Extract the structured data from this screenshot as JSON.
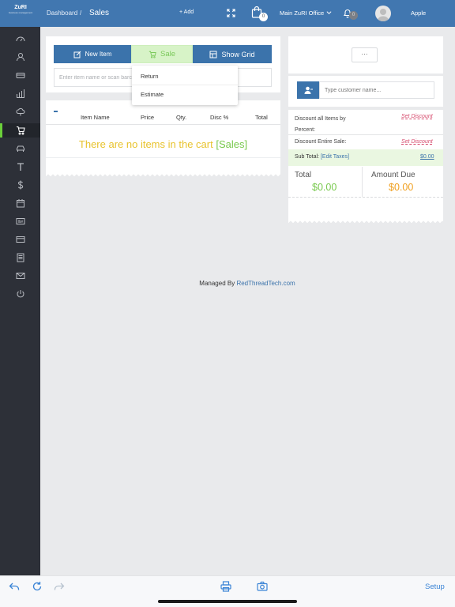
{
  "header": {
    "logo_text": "ZuRI",
    "logo_sub": "business management",
    "breadcrumb": "Dashboard",
    "breadcrumb_sep": "/",
    "title": "Sales",
    "add_label": "+ Add",
    "cart_badge": "0",
    "office": "Main ZuRI Office",
    "notif_badge": "0",
    "user": "Apple"
  },
  "sidebar": {
    "items": [
      "dashboard-icon",
      "customers-icon",
      "inventory-icon",
      "reports-icon",
      "cloud-icon",
      "sales-icon",
      "vehicle-icon",
      "text-icon",
      "dollar-icon",
      "calendar-icon",
      "id-card-icon",
      "credit-card-icon",
      "document-icon",
      "mail-icon",
      "power-icon"
    ],
    "active": "sales-icon"
  },
  "toolbar": {
    "new_item": "New Item",
    "sale": "Sale",
    "show_grid": "Show Grid"
  },
  "search": {
    "placeholder": "Enter item name or scan barcode"
  },
  "sale_menu": {
    "items": [
      "Return",
      "Estimate"
    ]
  },
  "cart": {
    "columns": [
      "Item Name",
      "Price",
      "Qty.",
      "Disc %",
      "Total"
    ],
    "empty_text": "There are no items in the cart",
    "empty_tag": "[Sales]"
  },
  "right": {
    "more_label": "···",
    "customer_placeholder": "Type customer name...",
    "discount_percent_label": "Discount all Items by Percent:",
    "discount_entire_label": "Discount Entire Sale:",
    "set_discount": "Set Discount",
    "subtotal_label": "Sub Total:",
    "edit_taxes": "[Edit Taxes]",
    "subtotal_value": "$0.00",
    "total_label": "Total",
    "total_value": "$0.00",
    "amount_due_label": "Amount Due",
    "amount_due_value": "$0.00"
  },
  "footer": {
    "managed_by": "Managed By",
    "company": "RedThreadTech.com"
  },
  "bottom": {
    "setup": "Setup"
  },
  "colors": {
    "primary": "#3b73ab",
    "topbar": "#4177b0",
    "sidebar": "#2d3038",
    "sale_green": "#79c94e",
    "warning_yellow": "#e8c32e",
    "amount_due_orange": "#f0a020",
    "discount_pink": "#d64a6c"
  }
}
